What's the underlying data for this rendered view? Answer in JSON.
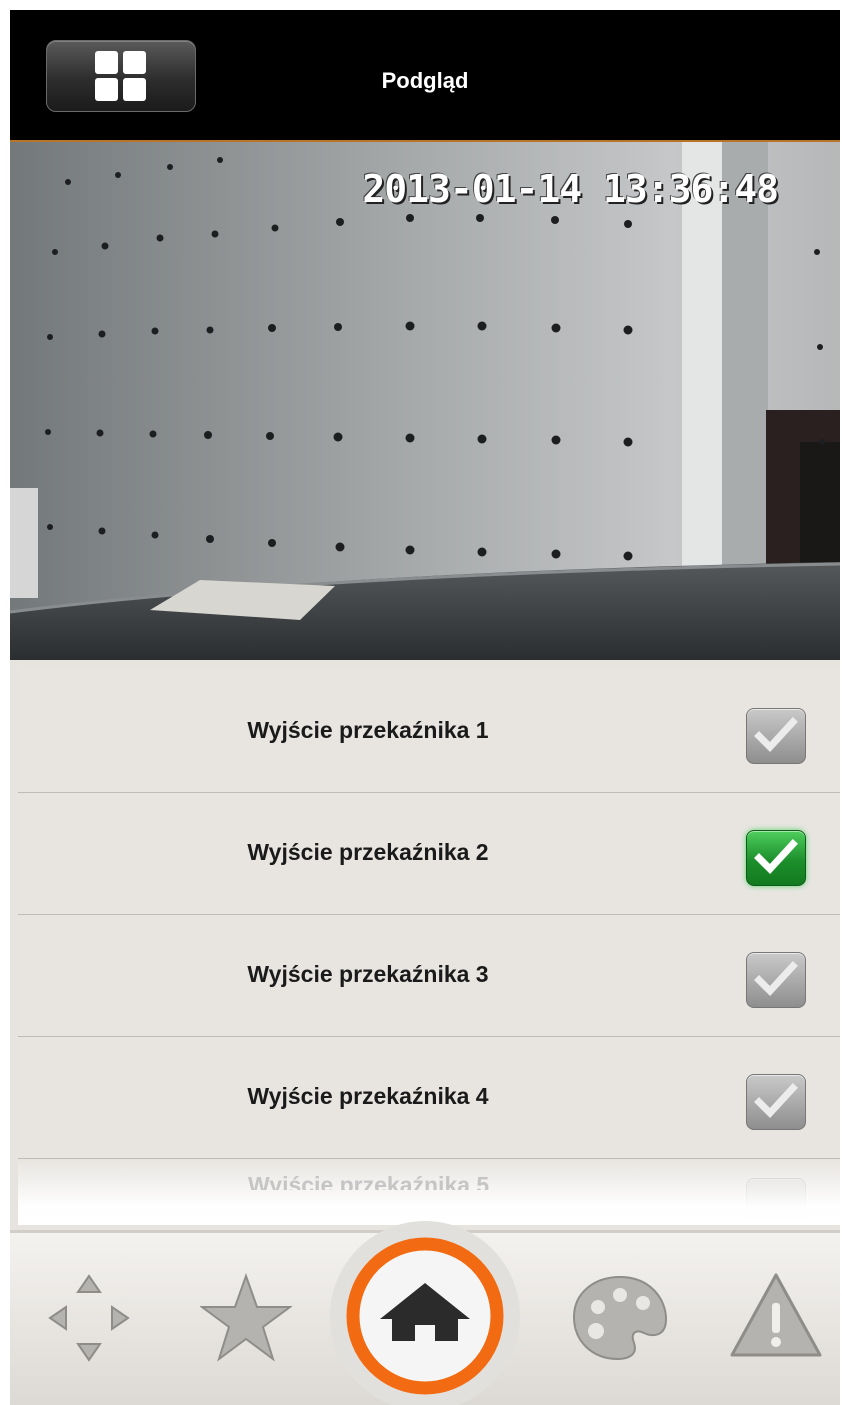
{
  "header": {
    "title": "Podgląd",
    "grid_button_icon": "grid-view-icon"
  },
  "camera": {
    "timestamp": "2013-01-14 13:36:48"
  },
  "relays": [
    {
      "label": "Wyjście przekaźnika 1",
      "checked": false
    },
    {
      "label": "Wyjście przekaźnika 2",
      "checked": true
    },
    {
      "label": "Wyjście przekaźnika 3",
      "checked": false
    },
    {
      "label": "Wyjście przekaźnika 4",
      "checked": false
    }
  ],
  "partial_row": {
    "label": "Wyjście przekaźnika 5"
  },
  "bottom_nav": [
    {
      "icon": "ptz-arrows-icon"
    },
    {
      "icon": "star-icon"
    },
    {
      "icon": "home-icon",
      "active": true
    },
    {
      "icon": "palette-icon"
    },
    {
      "icon": "warning-icon"
    }
  ],
  "colors": {
    "accent_orange": "#f26b12",
    "checked_green": "#1d8f2c",
    "header_bg": "#000000"
  }
}
